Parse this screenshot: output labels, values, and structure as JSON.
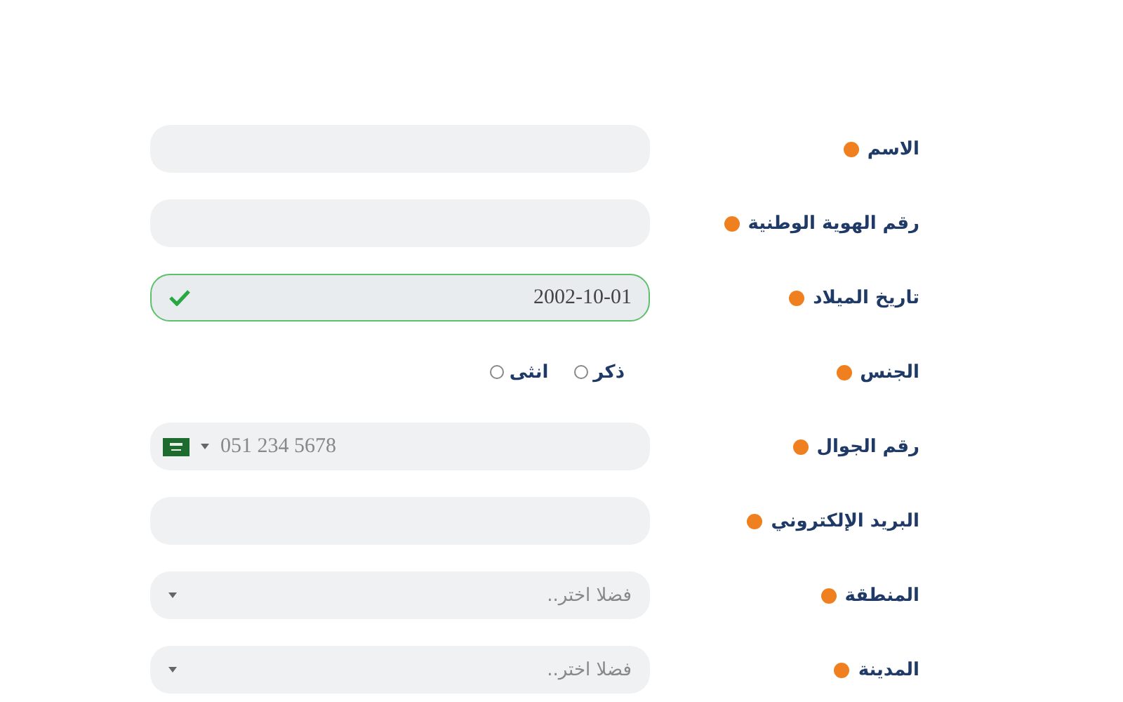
{
  "form": {
    "fields": [
      {
        "label": "الاسم",
        "required": true,
        "kind": "text"
      },
      {
        "label": "رقم الهوية الوطنية",
        "required": true,
        "kind": "text"
      },
      {
        "label": "تاريخ الميلاد",
        "required": true,
        "kind": "date",
        "value": "2002-10-01",
        "valid": true
      },
      {
        "label": "الجنس",
        "required": true,
        "kind": "radio",
        "options": [
          {
            "label": "ذكر",
            "selected": false
          },
          {
            "label": "انثى",
            "selected": false
          }
        ]
      },
      {
        "label": "رقم الجوال",
        "required": true,
        "kind": "phone",
        "placeholder": "051 234 5678"
      },
      {
        "label": "البريد الإلكتروني",
        "required": true,
        "kind": "text"
      },
      {
        "label": "المنطقة",
        "required": true,
        "kind": "select",
        "placeholder": "فضلا اختر.."
      },
      {
        "label": "المدينة",
        "required": true,
        "kind": "select",
        "placeholder": "فضلا اختر.."
      }
    ]
  }
}
